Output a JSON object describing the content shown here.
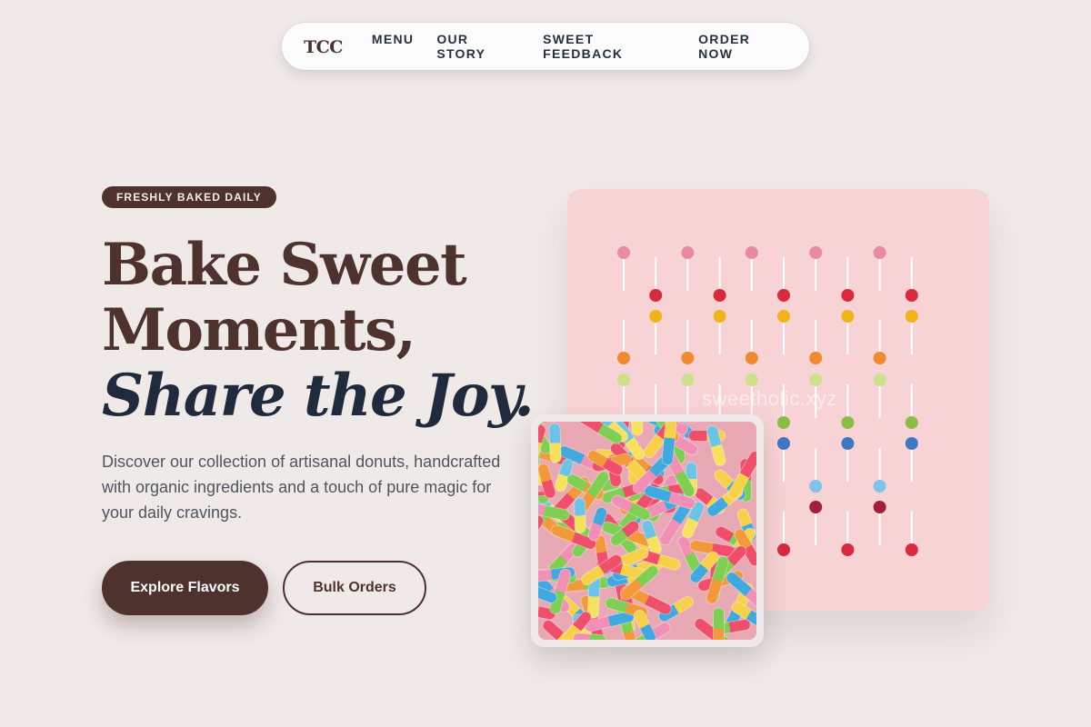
{
  "nav": {
    "logo": "TCC",
    "links": [
      "MENU",
      "OUR STORY",
      "SWEET FEEDBACK",
      "ORDER NOW"
    ]
  },
  "hero": {
    "badge": "FRESHLY BAKED DAILY",
    "headline_line1": "Bake Sweet",
    "headline_line2": "Moments,",
    "headline_accent": "Share the Joy.",
    "description": "Discover our collection of artisanal donuts, handcrafted with organic ingredients and a touch of pure magic for your daily cravings.",
    "primary_cta": "Explore Flavors",
    "secondary_cta": "Bulk Orders"
  },
  "images": {
    "lollipops_watermark": "sweetholic.xyz",
    "lollipops_icon": "lollipop-grid-image",
    "candy_icon": "sour-gummy-worms-image"
  },
  "colors": {
    "background": "#efe9e8",
    "brand_brown": "#4e322d",
    "accent_navy": "#1f2a3d",
    "pink_card": "#f8d3d5"
  }
}
